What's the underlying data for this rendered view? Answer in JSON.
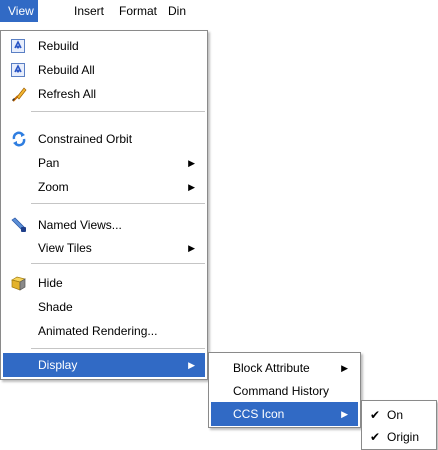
{
  "menubar": {
    "items": [
      {
        "label": "View"
      },
      {
        "label": "Insert"
      },
      {
        "label": "Format"
      },
      {
        "label": "Din"
      }
    ]
  },
  "view_menu": {
    "items": [
      {
        "label": "Rebuild",
        "icon": "rebuild-icon"
      },
      {
        "label": "Rebuild All",
        "icon": "rebuild-all-icon"
      },
      {
        "label": "Refresh All",
        "icon": "refresh-all-icon"
      },
      {
        "label": "Constrained Orbit",
        "icon": "orbit-icon"
      },
      {
        "label": "Pan",
        "submenu": true
      },
      {
        "label": "Zoom",
        "submenu": true
      },
      {
        "label": "Named Views...",
        "icon": "named-views-icon"
      },
      {
        "label": "View Tiles",
        "submenu": true
      },
      {
        "label": "Hide",
        "icon": "hide-icon"
      },
      {
        "label": "Shade"
      },
      {
        "label": "Animated Rendering..."
      },
      {
        "label": "Display",
        "submenu": true,
        "highlighted": true
      }
    ]
  },
  "display_submenu": {
    "items": [
      {
        "label": "Block Attribute",
        "submenu": true
      },
      {
        "label": "Command History"
      },
      {
        "label": "CCS Icon",
        "submenu": true,
        "highlighted": true
      }
    ]
  },
  "ccs_icon_submenu": {
    "items": [
      {
        "label": "On",
        "checked": true
      },
      {
        "label": "Origin",
        "checked": true
      }
    ]
  },
  "colors": {
    "highlight": "#316ac5",
    "menu_border": "#8a8a8a"
  }
}
